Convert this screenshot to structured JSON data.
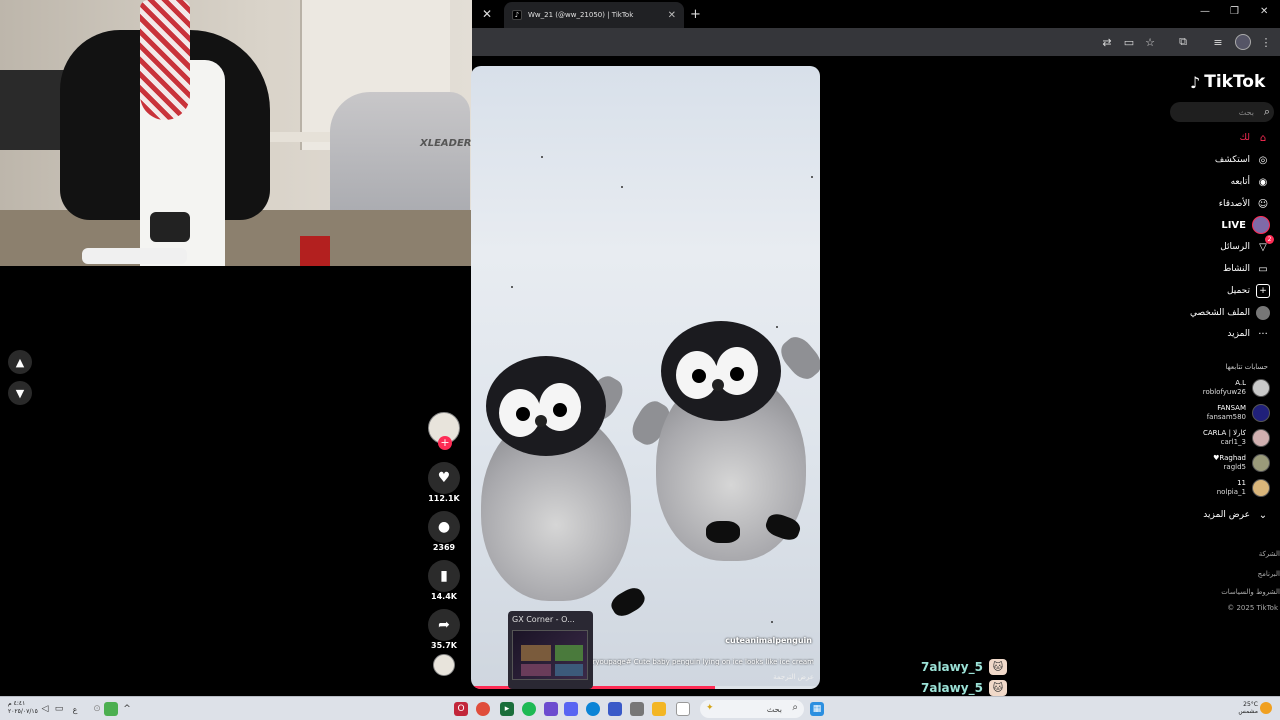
{
  "browser": {
    "tab_title": "Ww_21 (@ww_21050) | TikTok",
    "tab_favicon": "♪",
    "new_tab_label": "+"
  },
  "tiktok": {
    "logo_text": "TikTok",
    "search_placeholder": "بحث",
    "nav": [
      {
        "label": "لك",
        "icon": "home-icon",
        "active": true
      },
      {
        "label": "استكشف",
        "icon": "compass-icon"
      },
      {
        "label": "أتابعه",
        "icon": "following-icon"
      },
      {
        "label": "الأصدقاء",
        "icon": "friends-icon"
      },
      {
        "label": "LIVE",
        "icon": "live-icon"
      },
      {
        "label": "الرسائل",
        "icon": "messages-icon",
        "badge": "2"
      },
      {
        "label": "النشاط",
        "icon": "activity-icon"
      },
      {
        "label": "تحميل",
        "icon": "upload-icon"
      },
      {
        "label": "الملف الشخصي",
        "icon": "profile-icon"
      },
      {
        "label": "المزيد",
        "icon": "more-icon"
      }
    ],
    "following_title": "حسابات تتابعها",
    "following": [
      {
        "name": "A.L",
        "username": "roblofyuw26",
        "color": "#c9c9c9"
      },
      {
        "name": "FANSAM",
        "username": "fansam580",
        "color": "#20207a"
      },
      {
        "name": "CARLA | كارلا",
        "username": "carl1_3",
        "color": "#d0b0b0"
      },
      {
        "name": "♥Raghad",
        "username": "ragld5",
        "color": "#9a9a7a"
      },
      {
        "name": "11",
        "username": "nolpia_1",
        "color": "#d9b57a"
      }
    ],
    "see_more": "عرض المزيد",
    "footer": [
      "الشركة",
      "البرنامج",
      "الشروط والسياسات",
      "© 2025 TikTok"
    ]
  },
  "video": {
    "username": "cuteanimalpenguin",
    "caption": "viral# ... foryoupage# Cute baby penguin lying on ice looks like ice cream",
    "translate": "عرض الترجمة",
    "progress": 0.7
  },
  "actions": {
    "likes": "112.1K",
    "comments": "2369",
    "saves": "14.4K",
    "shares": "35.7K"
  },
  "popup": {
    "title": "GX Corner - O..."
  },
  "webcam": {
    "chair_brand": "XLEADER"
  },
  "chat": [
    {
      "user": "7alawy_5"
    },
    {
      "user": "7alawy_5"
    }
  ],
  "taskbar": {
    "search_label": "بحث",
    "clock_time": "٤:٤١ م",
    "clock_date": "٢٠٢٥/٠٧/١٥",
    "lang": "ع",
    "weather_temp": "25°C",
    "weather_desc": "مشمس"
  }
}
